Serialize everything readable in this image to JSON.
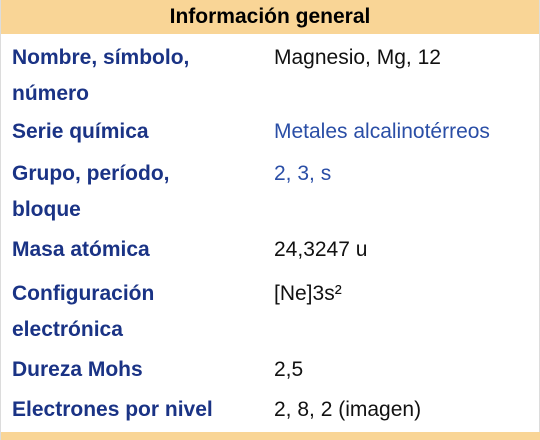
{
  "infobox": {
    "header": "Información general",
    "rows": [
      {
        "label_lines": [
          "Nombre, símbolo,",
          "número"
        ],
        "value": "Magnesio, Mg, 12",
        "value_is_link": false
      },
      {
        "label_lines": [
          "Serie química"
        ],
        "value": "Metales alcalinotérreos",
        "value_is_link": true
      },
      {
        "label_lines": [
          "Grupo, período,",
          "bloque"
        ],
        "value": "2, 3, s",
        "value_is_link": true
      },
      {
        "label_lines": [
          "Masa atómica"
        ],
        "value": "24,3247 u",
        "value_is_link": false
      },
      {
        "label_lines": [
          "Configuración",
          "electrónica"
        ],
        "value": "[Ne]3s²",
        "value_is_link": false
      },
      {
        "label_lines": [
          "Dureza Mohs"
        ],
        "value": "2,5",
        "value_is_link": false
      },
      {
        "label_lines": [
          "Electrones por nivel"
        ],
        "value": "2, 8, 2 (imagen)",
        "value_is_link": false
      }
    ],
    "colors": {
      "header_bg": "#f9d596",
      "label_text": "#1a3385",
      "link_text": "#2a4ea6",
      "value_text": "#111111"
    }
  }
}
